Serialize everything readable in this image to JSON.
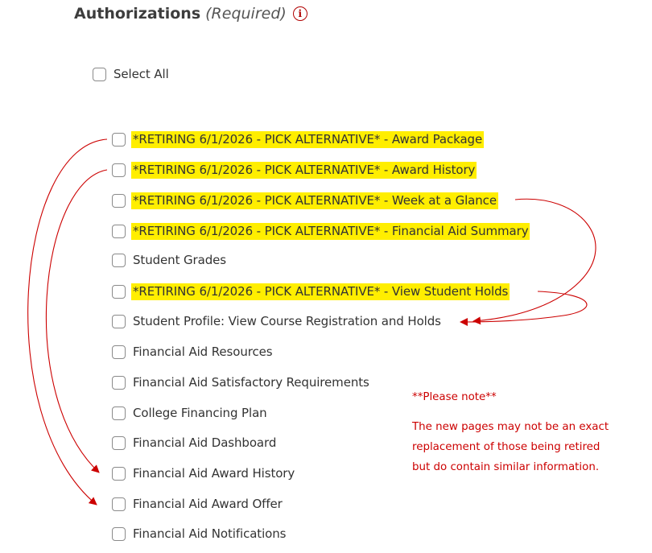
{
  "section": {
    "title": "Authorizations",
    "required": "(Required)",
    "info_icon": "info-icon",
    "select_all": "Select All"
  },
  "authorizations": [
    {
      "label": "*RETIRING 6/1/2026 - PICK ALTERNATIVE* - Award Package",
      "highlighted": true,
      "checked": false
    },
    {
      "label": "*RETIRING 6/1/2026 - PICK ALTERNATIVE* - Award History",
      "highlighted": true,
      "checked": false
    },
    {
      "label": "*RETIRING 6/1/2026 - PICK ALTERNATIVE* - Week at a Glance",
      "highlighted": true,
      "checked": false
    },
    {
      "label": "*RETIRING 6/1/2026 - PICK ALTERNATIVE* - Financial Aid Summary",
      "highlighted": true,
      "checked": false
    },
    {
      "label": "Student Grades",
      "highlighted": false,
      "checked": false
    },
    {
      "label": "*RETIRING 6/1/2026 - PICK ALTERNATIVE* - View Student Holds",
      "highlighted": true,
      "checked": false
    },
    {
      "label": "Student Profile: View Course Registration and Holds",
      "highlighted": false,
      "checked": false
    },
    {
      "label": "Financial Aid Resources",
      "highlighted": false,
      "checked": false
    },
    {
      "label": "Financial Aid Satisfactory Requirements",
      "highlighted": false,
      "checked": false
    },
    {
      "label": "College Financing Plan",
      "highlighted": false,
      "checked": false
    },
    {
      "label": "Financial Aid Dashboard",
      "highlighted": false,
      "checked": false
    },
    {
      "label": "Financial Aid Award History",
      "highlighted": false,
      "checked": false
    },
    {
      "label": "Financial Aid Award Offer",
      "highlighted": false,
      "checked": false
    },
    {
      "label": "Financial Aid Notifications",
      "highlighted": false,
      "checked": false
    }
  ],
  "note": {
    "heading": "**Please note**",
    "lines": [
      "The new pages may not be an exact",
      "replacement of those being retired",
      "but do contain similar information."
    ]
  },
  "colors": {
    "highlight": "#ffee00",
    "annotation": "#cc0000",
    "checkbox_border": "#8a8a8a"
  }
}
